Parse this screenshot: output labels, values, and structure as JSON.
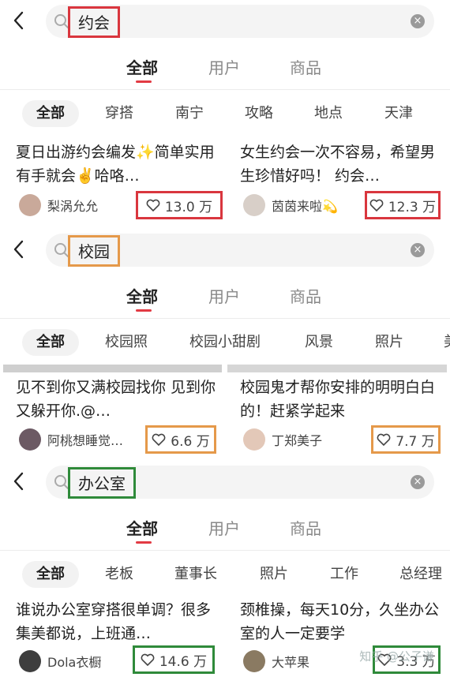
{
  "panels": [
    {
      "keyword": "约会",
      "tabs": [
        "全部",
        "用户",
        "商品"
      ],
      "chips": [
        "全部",
        "穿搭",
        "南宁",
        "攻略",
        "地点",
        "天津"
      ],
      "cards": [
        {
          "title": "夏日出游约会编发✨简单实用有手就会✌️哈咯…",
          "author": "梨涡允允",
          "likes": "13.0 万"
        },
        {
          "title": "女生约会一次不容易，希望男生珍惜好吗！ 约会…",
          "author": "茵茵来啦💫",
          "likes": "12.3 万"
        }
      ]
    },
    {
      "keyword": "校园",
      "tabs": [
        "全部",
        "用户",
        "商品"
      ],
      "chips": [
        "全部",
        "校园照",
        "校园小甜剧",
        "风景",
        "照片",
        "美"
      ],
      "cards": [
        {
          "title": "见不到你又满校园找你 见到你又躲开你.@…",
          "author": "阿桃想睡觉…",
          "likes": "6.6 万"
        },
        {
          "title": "校园鬼才帮你安排的明明白白的！赶紧学起来",
          "author": "丁郑美子",
          "likes": "7.7 万"
        }
      ]
    },
    {
      "keyword": "办公室",
      "tabs": [
        "全部",
        "用户",
        "商品"
      ],
      "chips": [
        "全部",
        "老板",
        "董事长",
        "照片",
        "工作",
        "总经理"
      ],
      "cards": [
        {
          "title": "谁说办公室穿搭很单调？很多集美都说，上班通…",
          "author": "Dola衣橱",
          "likes": "14.6 万"
        },
        {
          "title": "颈椎操，每天10分，久坐办公室的人一定要学",
          "author": "大苹果",
          "likes": "3.3 万"
        }
      ]
    }
  ],
  "watermark": "知乎 @公子谦",
  "colors": {
    "annotation_red": "#d9363e",
    "annotation_orange": "#e5994a",
    "annotation_green": "#2f8a3a",
    "tab_underline": "#e23a43"
  },
  "icons": {
    "back": "chevron-left-icon",
    "search": "search-icon",
    "clear": "clear-icon",
    "like": "heart-icon"
  }
}
